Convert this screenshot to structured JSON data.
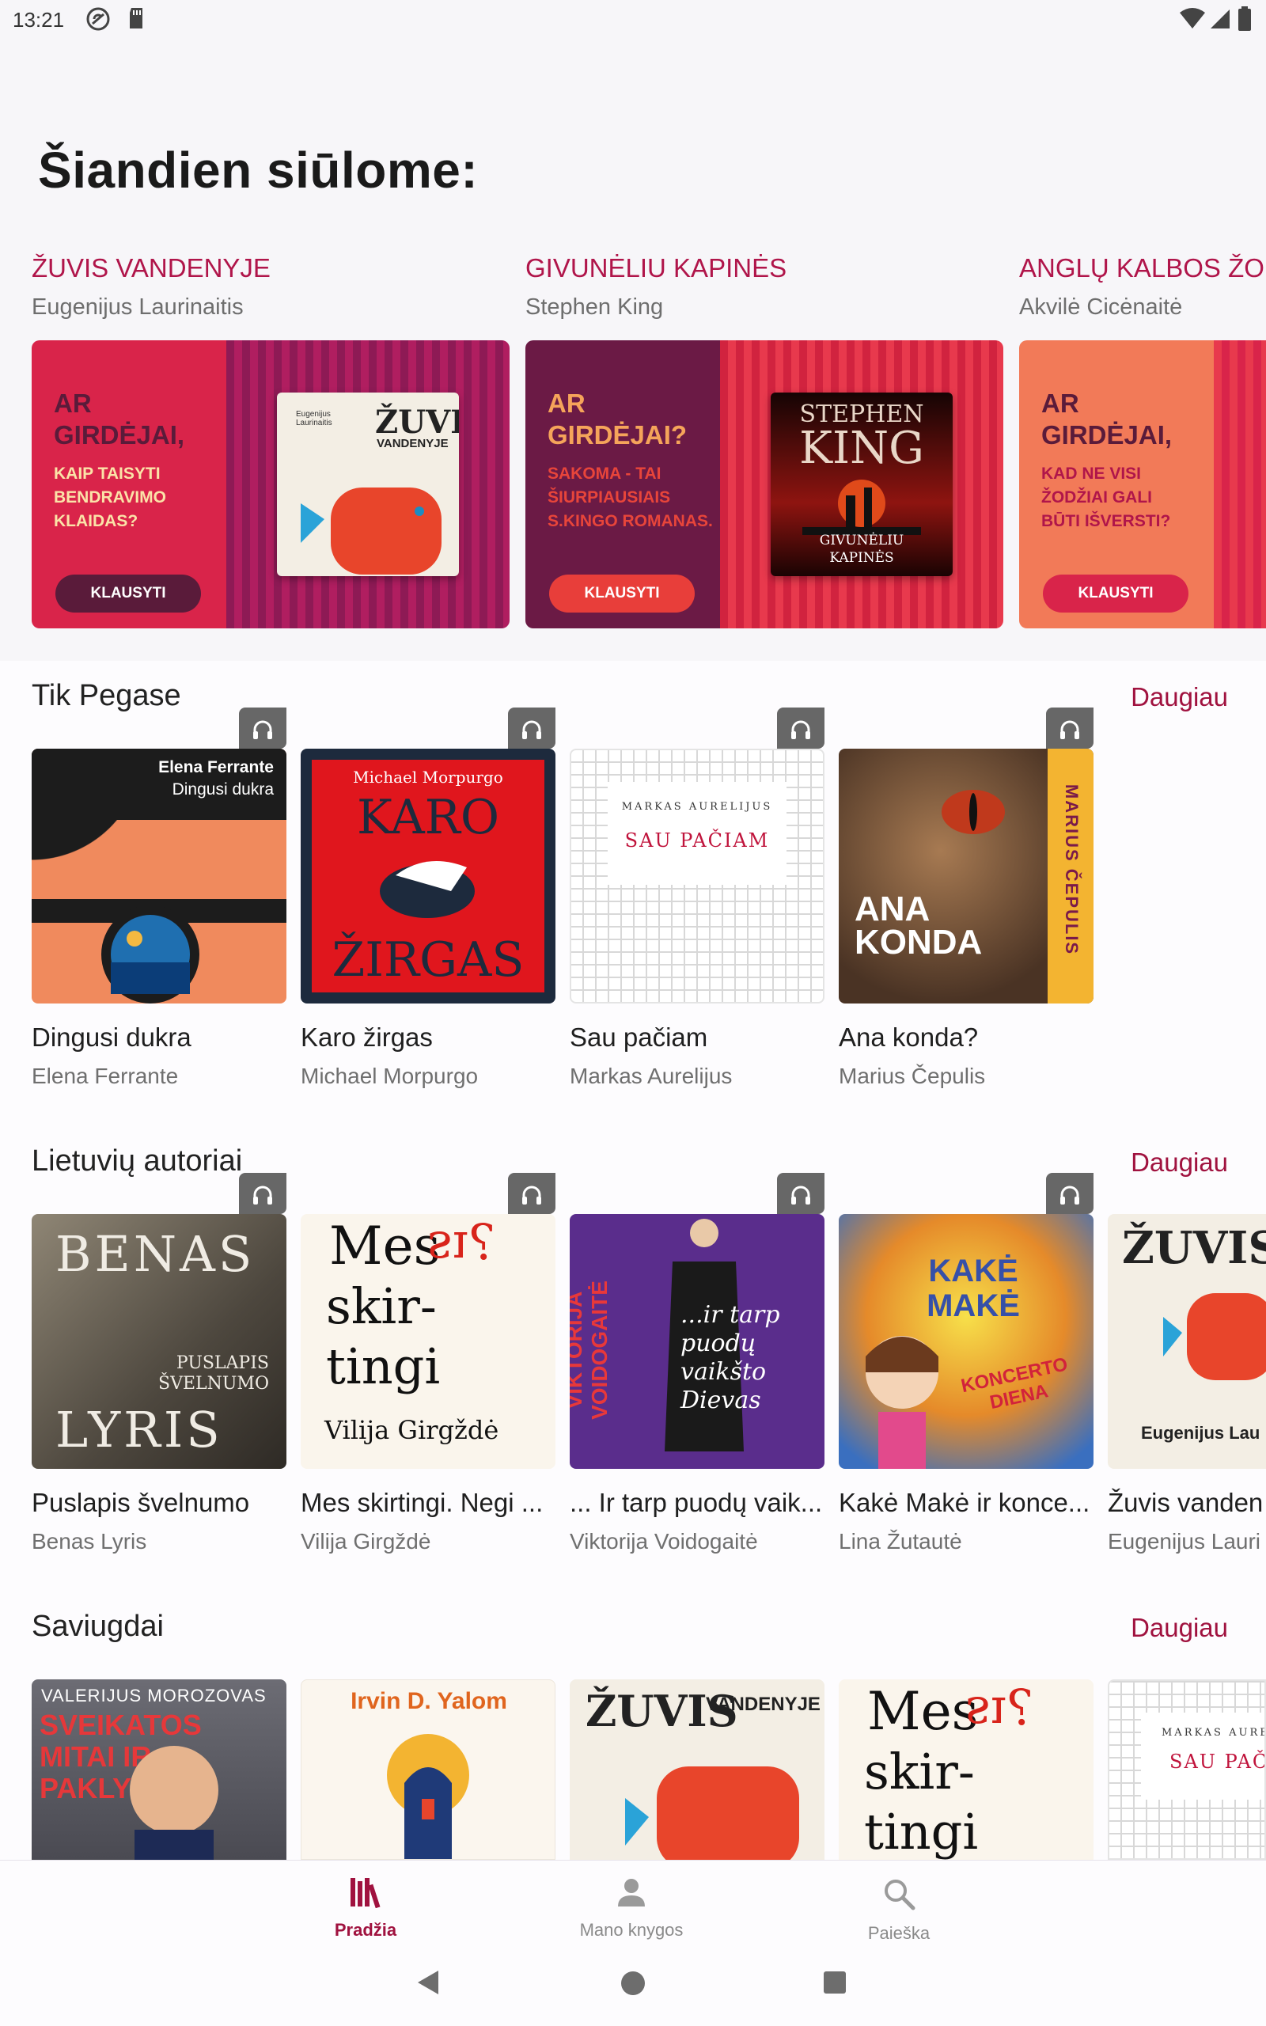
{
  "status_bar": {
    "time": "13:21"
  },
  "page_title": "Šiandien siūlome:",
  "promos": [
    {
      "title": "ŽUVIS VANDENYJE",
      "author": "Eugenijus Laurinaitis",
      "question": "AR GIRDĖJAI,",
      "subtitle": "KAIP TAISYTI BENDRAVIMO KLAIDAS?",
      "cta": "KLAUSYTI",
      "cover_author": "Eugenijus Laurinaitis",
      "cover_title": "ŽUVIS",
      "cover_sub": "VANDENYJE"
    },
    {
      "title": "GIVUNĖLIU KAPINĖS",
      "author": "Stephen King",
      "question": "AR GIRDĖJAI?",
      "subtitle": "SAKOMA - TAI ŠIURPIAUSIAIS S.KINGO ROMANAS.",
      "cta": "KLAUSYTI",
      "cover_author": "STEPHEN",
      "cover_title": "KING",
      "cover_sub": "GIVUNĖLIU KAPINĖS"
    },
    {
      "title": "ANGLŲ KALBOS ŽOD",
      "author": "Akvilė Cicėnaitė",
      "question": "AR GIRDĖJAI,",
      "subtitle": "KAD NE VISI ŽODŽIAI GALI BŪTI IŠVERSTI?",
      "cta": "KLAUSYTI"
    }
  ],
  "sections": [
    {
      "title": "Tik Pegase",
      "more": "Daugiau",
      "books": [
        {
          "title": "Dingusi dukra",
          "author": "Elena Ferrante",
          "cover_text": "Elena Ferrante",
          "cover_text2": "Dingusi dukra"
        },
        {
          "title": "Karo žirgas",
          "author": "Michael Morpurgo",
          "cover_text": "Michael Morpurgo",
          "cover_text2": "KARO",
          "cover_text3": "ŽIRGAS"
        },
        {
          "title": "Sau pačiam",
          "author": "Markas Aurelijus",
          "cover_text": "MARKAS AURELIJUS",
          "cover_text2": "SAU PAČIAM"
        },
        {
          "title": "Ana konda?",
          "author": "Marius Čepulis",
          "cover_text": "ANA",
          "cover_text2": "KONDA",
          "cover_text3": "MARIUS ČEPULIS"
        }
      ]
    },
    {
      "title": "Lietuvių autoriai",
      "more": "Daugiau",
      "books": [
        {
          "title": "Puslapis švelnumo",
          "author": "Benas Lyris",
          "cover_text": "BENAS",
          "cover_text2": "LYRIS",
          "cover_text3": "PUSLAPIS ŠVELNUMO"
        },
        {
          "title": "Mes skirtingi. Negi ...",
          "author": "Vilija Girgždė",
          "cover_text": "Mes",
          "cover_text2": "Vilija Girgždė"
        },
        {
          "title": "... Ir tarp puodų vaik...",
          "author": "Viktorija Voidogaitė",
          "cover_text": "...ir tarp puodų vaikšto Dievas",
          "cover_text2": "VIKTORIJA VOIDOGAITĖ"
        },
        {
          "title": "Kakė Makė ir konce...",
          "author": "Lina Žutautė",
          "cover_text": "KAKĖ MAKĖ",
          "cover_text2": "KONCERTO DIENA"
        },
        {
          "title": "Žuvis vanden",
          "author": "Eugenijus Lauri",
          "cover_text": "ŽUVIS",
          "cover_text2": "Eugenijus Lau"
        }
      ]
    },
    {
      "title": "Saviugdai",
      "more": "Daugiau",
      "books": [
        {
          "cover_text": "VALERIJUS MOROZOVAS",
          "cover_text2": "SVEIKATOS MITAI IR PAKLYDIMAI"
        },
        {
          "cover_text": "Irvin D. Yalom"
        },
        {
          "cover_text": "ŽUVIS",
          "cover_text2": "VANDENYJE"
        },
        {
          "cover_text": "Mes"
        },
        {
          "cover_text": "MARKAS AURE",
          "cover_text2": "SAU PAČI"
        }
      ]
    }
  ],
  "bottom_nav": [
    {
      "label": "Pradžia",
      "icon": "library-icon",
      "active": true
    },
    {
      "label": "Mano knygos",
      "icon": "person-icon",
      "active": false
    },
    {
      "label": "Paieška",
      "icon": "search-icon",
      "active": false
    }
  ],
  "colors": {
    "accent": "#a0123f",
    "banner_red": "#d9244a",
    "banner_purple": "#6b1a45",
    "banner_orange": "#f27a58"
  }
}
